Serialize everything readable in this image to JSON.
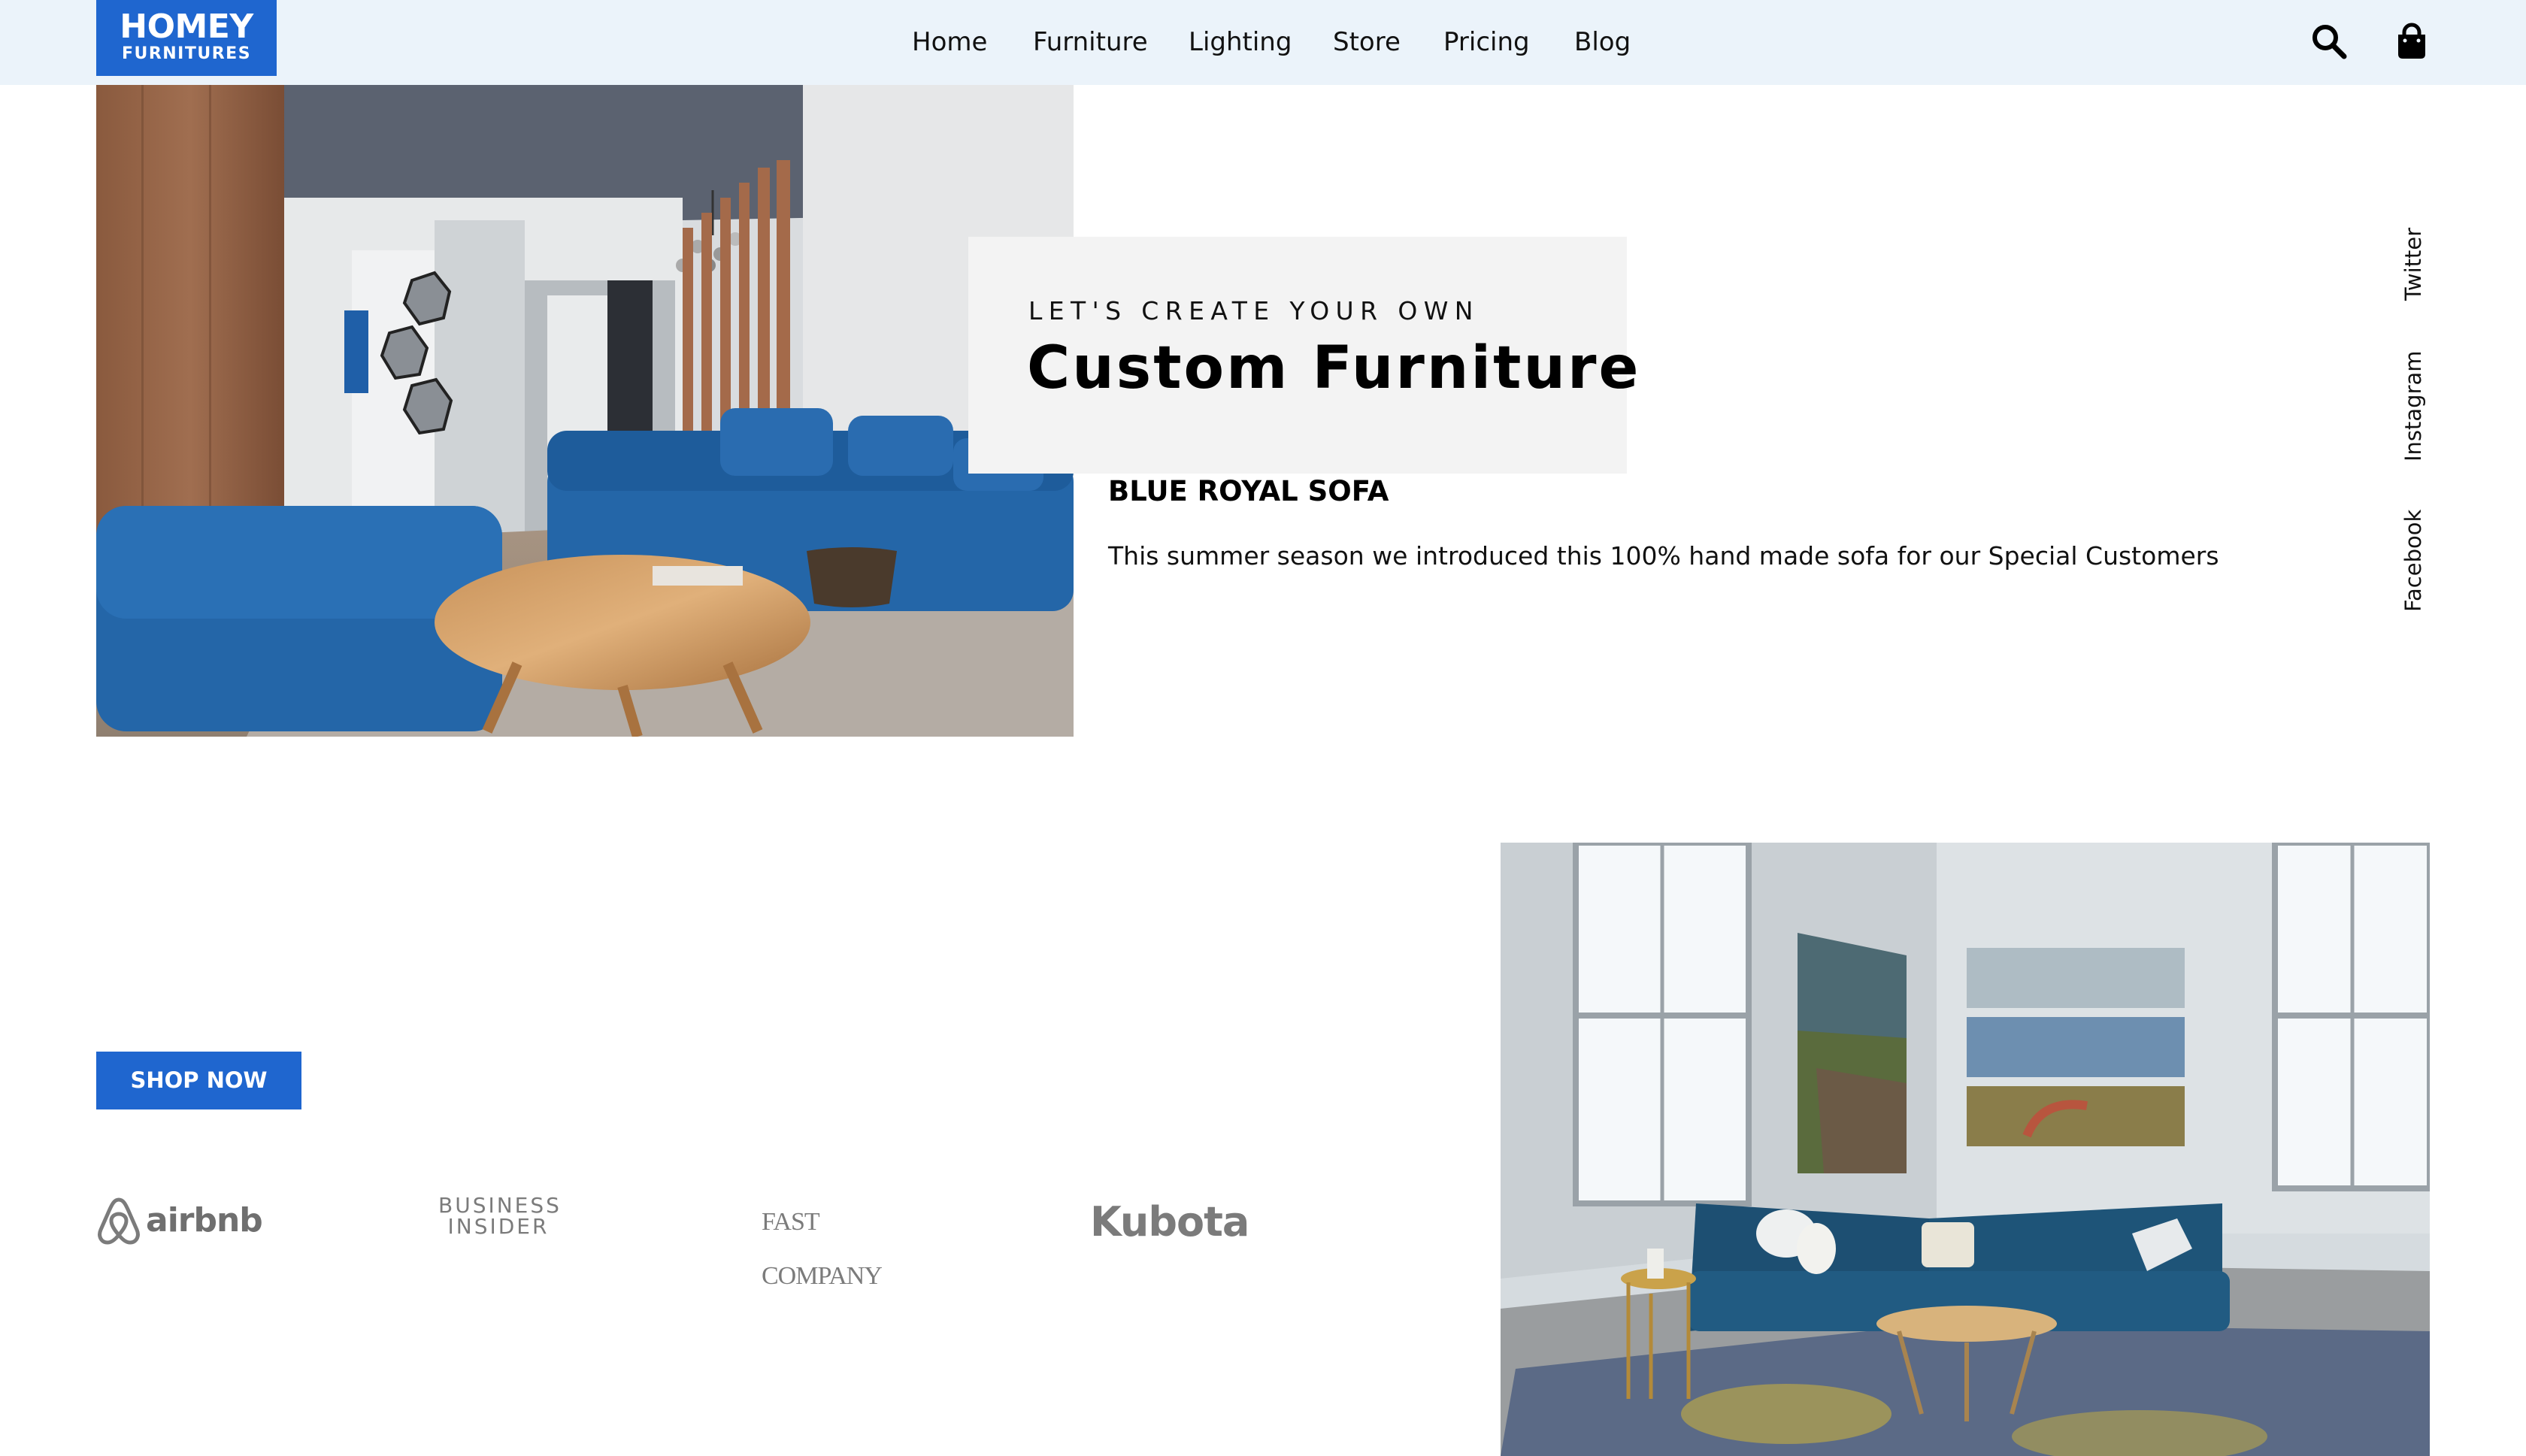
{
  "logo": {
    "main": "HOMEY",
    "sub": "FURNITURES"
  },
  "nav": {
    "items": [
      "Home",
      "Furniture",
      "Lighting",
      "Store",
      "Pricing",
      "Blog"
    ]
  },
  "header_icons": {
    "search": "search-icon",
    "cart": "shopping-bag-icon"
  },
  "hero": {
    "subtitle": "LET'S CREATE YOUR OWN",
    "title": "Custom Furniture",
    "product_name": "BLUE ROYAL SOFA",
    "product_description": "This summer season we introduced this 100% hand made sofa for our Special Customers"
  },
  "social": [
    "Twitter",
    "Instagram",
    "Facebook"
  ],
  "cta": {
    "shop_now": "SHOP NOW"
  },
  "brands": {
    "airbnb": "airbnb",
    "business_insider": [
      "BUSINESS",
      "INSIDER"
    ],
    "fast_company": "FAST COMPANY",
    "kubota": "Kubota"
  },
  "colors": {
    "accent": "#1f66cf",
    "header_bg": "#ebf3fa",
    "overlay_bg": "#f3f3f3"
  }
}
